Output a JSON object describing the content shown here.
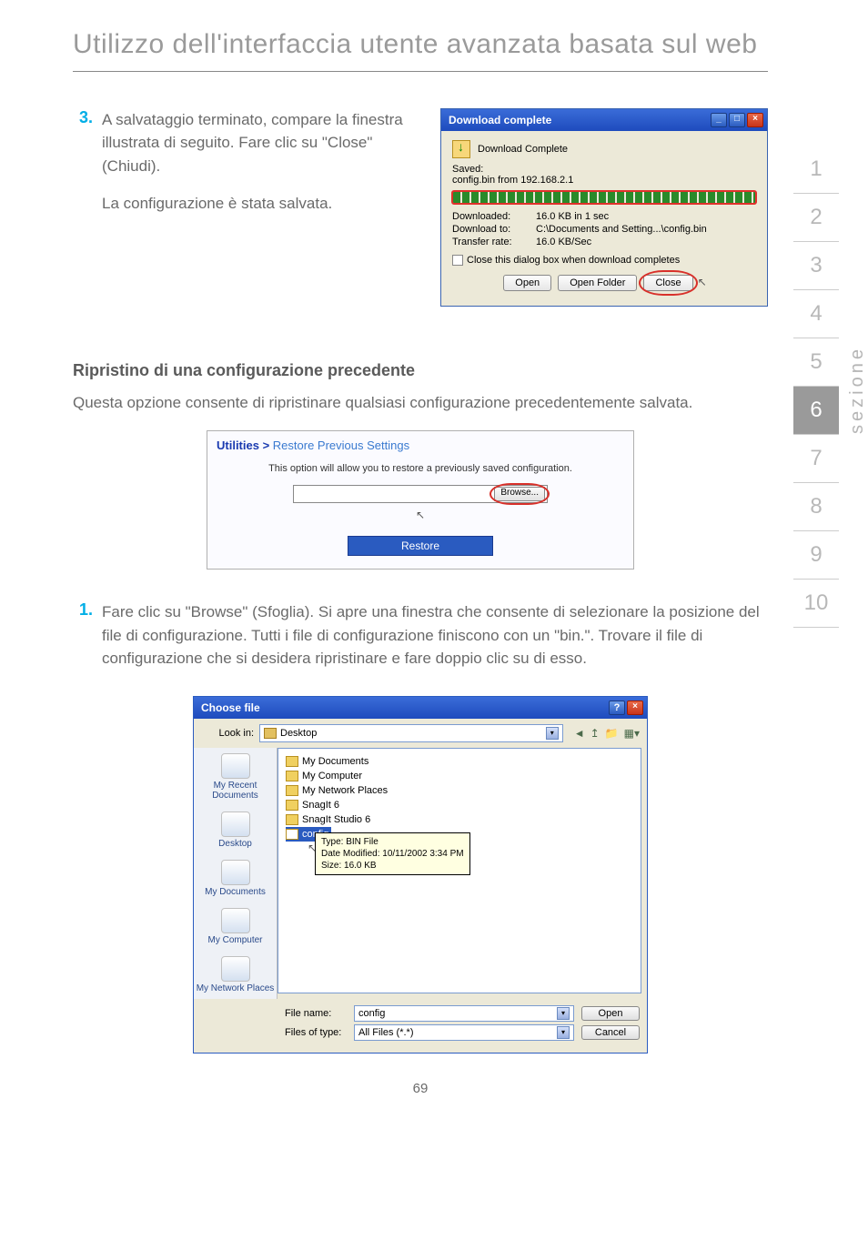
{
  "page": {
    "title": "Utilizzo dell'interfaccia utente avanzata basata sul web",
    "number": "69"
  },
  "nav": {
    "label": "sezione",
    "items": [
      "1",
      "2",
      "3",
      "4",
      "5",
      "6",
      "7",
      "8",
      "9",
      "10"
    ],
    "active_index": 5
  },
  "step3": {
    "num": "3.",
    "text_a": "A salvataggio terminato, compare la finestra illustrata di seguito. Fare clic su \"Close\" (Chiudi).",
    "text_b": "La configurazione è stata salvata."
  },
  "dl_dialog": {
    "title": "Download complete",
    "subtitle": "Download Complete",
    "saved_lbl": "Saved:",
    "saved_val": "config.bin from 192.168.2.1",
    "rows": {
      "downloaded_lbl": "Downloaded:",
      "downloaded_val": "16.0 KB in 1 sec",
      "to_lbl": "Download to:",
      "to_val": "C:\\Documents and Setting...\\config.bin",
      "rate_lbl": "Transfer rate:",
      "rate_val": "16.0 KB/Sec"
    },
    "checkbox": "Close this dialog box when download completes",
    "btn_open": "Open",
    "btn_open_folder": "Open Folder",
    "btn_close": "Close"
  },
  "restore_section": {
    "heading": "Ripristino di una configurazione precedente",
    "intro": "Questa opzione consente di ripristinare qualsiasi configurazione precedentemente salvata."
  },
  "restore_panel": {
    "crumb_a": "Utilities >",
    "crumb_b": "Restore Previous Settings",
    "desc": "This option will allow you to restore a previously saved configuration.",
    "browse": "Browse...",
    "restore": "Restore"
  },
  "step1": {
    "num": "1.",
    "text": "Fare clic su \"Browse\" (Sfoglia). Si apre una finestra che consente di selezionare la posizione del file di configurazione. Tutti i file di configurazione finiscono con un \"bin.\". Trovare il file di configurazione che si desidera ripristinare e fare doppio clic su di esso."
  },
  "choose_dialog": {
    "title": "Choose file",
    "lookin_lbl": "Look in:",
    "lookin_val": "Desktop",
    "places": {
      "recent": "My Recent Documents",
      "desktop": "Desktop",
      "mydocs": "My Documents",
      "mycomp": "My Computer",
      "mynet": "My Network Places"
    },
    "files": {
      "mydocuments": "My Documents",
      "mycomputer": "My Computer",
      "mynetplaces": "My Network Places",
      "snagit6": "SnagIt 6",
      "snagitstudio6": "SnagIt Studio 6",
      "config": "config"
    },
    "tooltip": {
      "l1": "Type: BIN File",
      "l2": "Date Modified: 10/11/2002 3:34 PM",
      "l3": "Size: 16.0 KB"
    },
    "filename_lbl": "File name:",
    "filename_val": "config",
    "filetype_lbl": "Files of type:",
    "filetype_val": "All Files (*.*)",
    "btn_open": "Open",
    "btn_cancel": "Cancel"
  }
}
